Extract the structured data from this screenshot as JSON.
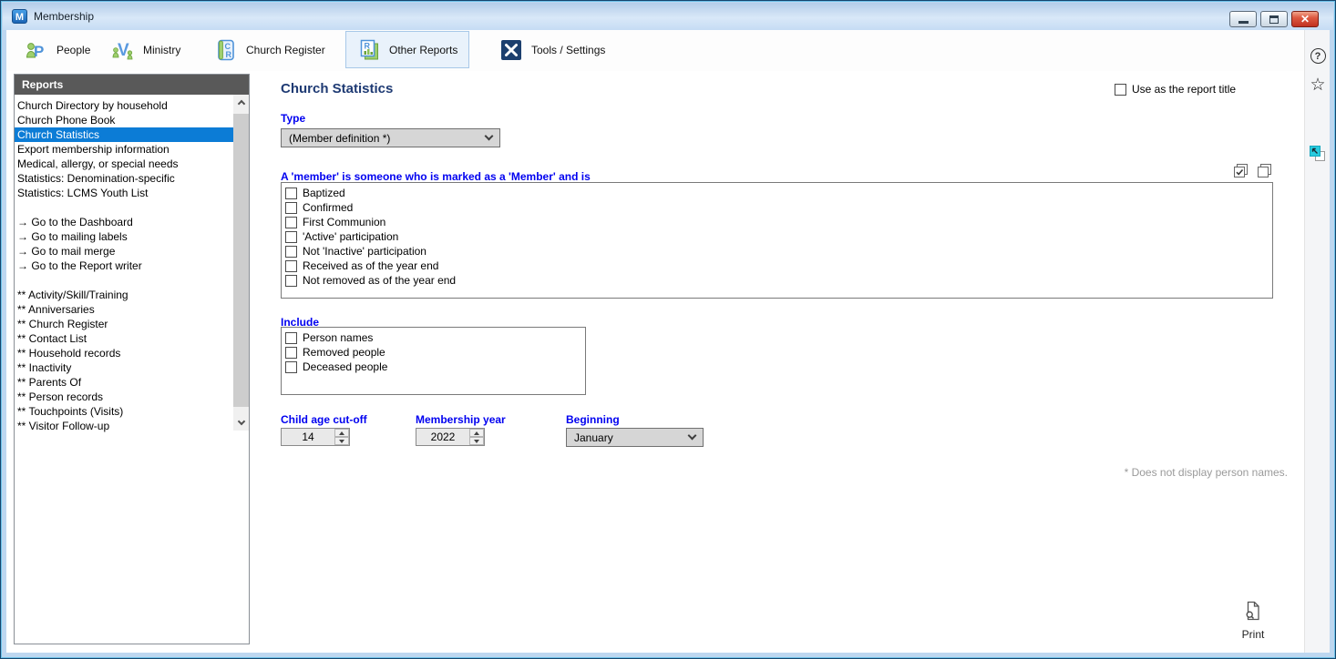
{
  "window": {
    "title": "Membership",
    "icon_letter": "M",
    "controls": {
      "minimize": "minimize",
      "maximize": "maximize",
      "close_glyph": "✕"
    }
  },
  "toolbar": {
    "tabs": [
      {
        "label": "People",
        "icon": "people-icon",
        "selected": false
      },
      {
        "label": "Ministry",
        "icon": "ministry-icon",
        "selected": false
      },
      {
        "label": "Church Register",
        "icon": "church-register-icon",
        "selected": false
      },
      {
        "label": "Other Reports",
        "icon": "other-reports-icon",
        "selected": true
      },
      {
        "label": "Tools / Settings",
        "icon": "tools-settings-icon",
        "selected": false
      }
    ]
  },
  "sidebar": {
    "header": "Reports",
    "items": [
      {
        "label": "Church Directory by household",
        "selected": false
      },
      {
        "label": "Church Phone Book",
        "selected": false
      },
      {
        "label": "Church Statistics",
        "selected": true
      },
      {
        "label": "Export membership information",
        "selected": false
      },
      {
        "label": "Medical, allergy, or special needs",
        "selected": false
      },
      {
        "label": "Statistics: Denomination-specific",
        "selected": false
      },
      {
        "label": "Statistics: LCMS Youth List",
        "selected": false
      },
      {
        "label": "",
        "selected": false
      },
      {
        "label": "→ Go to the Dashboard",
        "selected": false
      },
      {
        "label": "→ Go to mailing labels",
        "selected": false
      },
      {
        "label": "→ Go to mail merge",
        "selected": false
      },
      {
        "label": "→ Go to the Report writer",
        "selected": false
      },
      {
        "label": "",
        "selected": false
      },
      {
        "label": "** Activity/Skill/Training",
        "selected": false
      },
      {
        "label": "** Anniversaries",
        "selected": false
      },
      {
        "label": "** Church Register",
        "selected": false
      },
      {
        "label": "** Contact List",
        "selected": false
      },
      {
        "label": "** Household records",
        "selected": false
      },
      {
        "label": "** Inactivity",
        "selected": false
      },
      {
        "label": "** Parents Of",
        "selected": false
      },
      {
        "label": "** Person records",
        "selected": false
      },
      {
        "label": "** Touchpoints (Visits)",
        "selected": false
      },
      {
        "label": "** Visitor Follow-up",
        "selected": false
      }
    ]
  },
  "main": {
    "title": "Church Statistics",
    "use_as_report_title": {
      "label": "Use as the report title",
      "checked": false
    },
    "type": {
      "label": "Type",
      "value": "(Member definition *)"
    },
    "member_definition": {
      "label": "A 'member' is someone who is marked as a 'Member' and is",
      "options": [
        "Baptized",
        "Confirmed",
        "First Communion",
        "'Active' participation",
        "Not 'Inactive' participation",
        "Received as of the year end",
        "Not removed as of the year end"
      ]
    },
    "include": {
      "label": "Include",
      "options": [
        "Person names",
        "Removed people",
        "Deceased people"
      ]
    },
    "child_age_cutoff": {
      "label": "Child age cut-off",
      "value": "14"
    },
    "membership_year": {
      "label": "Membership year",
      "value": "2022"
    },
    "beginning": {
      "label": "Beginning",
      "value": "January"
    },
    "footnote": "* Does not display person names.",
    "print": {
      "label": "Print",
      "icon": "print-preview-icon"
    },
    "list_tools": {
      "check_all": "check-all-icon",
      "uncheck_all": "uncheck-all-icon"
    }
  },
  "right_rail": {
    "help": {
      "icon": "help-icon",
      "glyph": "?"
    },
    "favorite": {
      "icon": "favorite-star-icon",
      "glyph": "☆"
    },
    "popout": {
      "icon": "popout-icon"
    }
  },
  "colors": {
    "selection_blue": "#0c7cd6",
    "label_blue": "#0000f0",
    "title_navy": "#1e3a73",
    "reports_header_gray": "#595959",
    "selected_tab_bg": "#e9f2fb",
    "window_band_blue": "#bdd7f0",
    "close_red": "#c03220",
    "popout_teal": "#28cbdf"
  }
}
